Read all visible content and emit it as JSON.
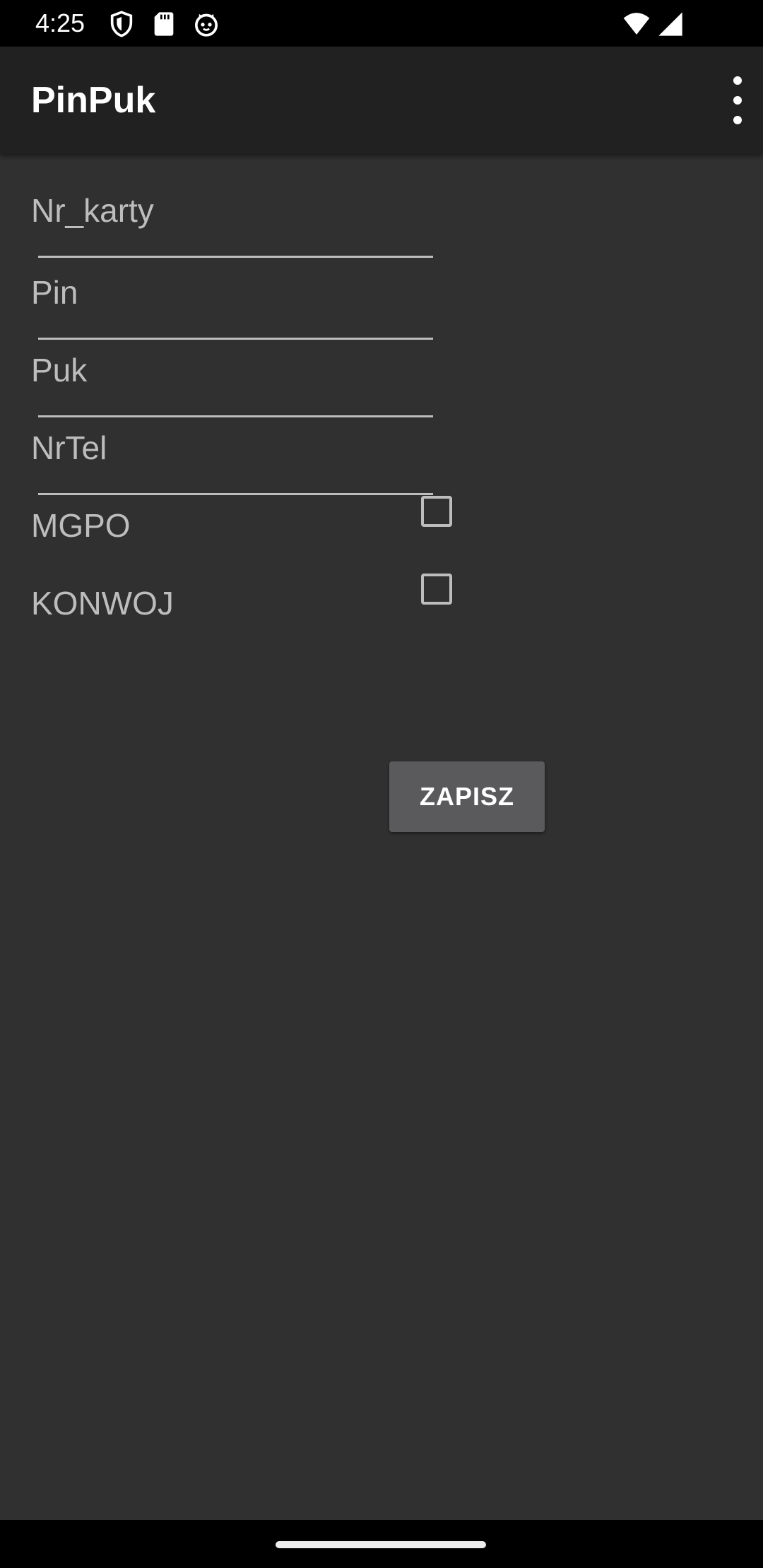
{
  "status_bar": {
    "time": "4:25",
    "icons": [
      "shield-icon",
      "sd-card-icon",
      "cat-face-icon",
      "wifi-icon",
      "signal-icon"
    ]
  },
  "app_bar": {
    "title": "PinPuk",
    "menu_icon": "more-vert-icon"
  },
  "form": {
    "fields": [
      {
        "placeholder": "Nr_karty",
        "value": ""
      },
      {
        "placeholder": "Pin",
        "value": ""
      },
      {
        "placeholder": "Puk",
        "value": ""
      },
      {
        "placeholder": "NrTel",
        "value": ""
      }
    ],
    "checkboxes": [
      {
        "label": "MGPO",
        "checked": false
      },
      {
        "label": "KONWOJ",
        "checked": false
      }
    ],
    "save_label": "ZAPISZ"
  },
  "colors": {
    "status_bar": "#000000",
    "app_bar": "#212121",
    "background": "#303030",
    "field_text": "#bdbdbd",
    "button": "#5a5a5c",
    "button_text": "#ffffff"
  }
}
